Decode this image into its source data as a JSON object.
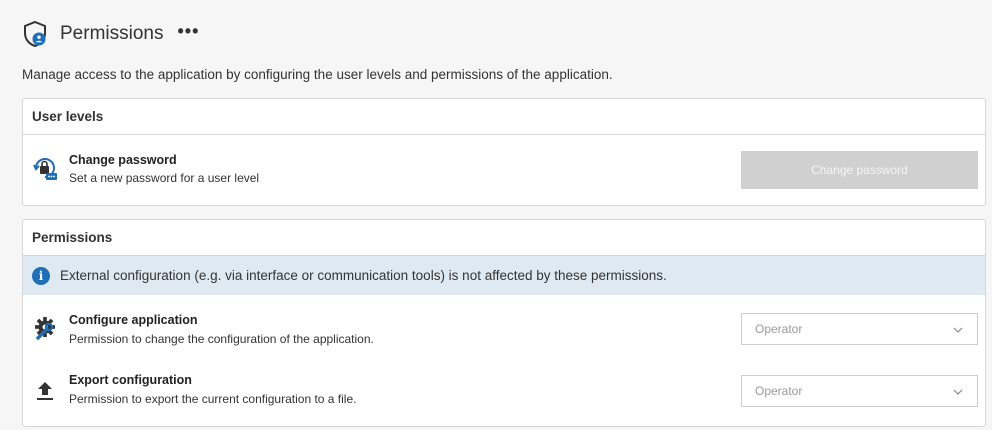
{
  "header": {
    "title": "Permissions",
    "more_label": "•••",
    "icon": "shield-user-icon"
  },
  "description": "Manage access to the application by configuring the user levels and permissions of the application.",
  "user_levels": {
    "heading": "User levels",
    "items": [
      {
        "icon": "lock-password-icon",
        "title": "Change password",
        "subtitle": "Set a new password for a user level",
        "button_label": "Change password",
        "button_enabled": false
      }
    ]
  },
  "permissions": {
    "heading": "Permissions",
    "info": {
      "icon": "info-icon",
      "text": "External configuration (e.g. via interface or communication tools) is not affected by these permissions."
    },
    "items": [
      {
        "icon": "gear-wrench-icon",
        "title": "Configure application",
        "subtitle": "Permission to change the configuration of the application.",
        "selected": "Operator"
      },
      {
        "icon": "upload-icon",
        "title": "Export configuration",
        "subtitle": "Permission to export the current configuration to a file.",
        "selected": "Operator"
      }
    ]
  },
  "colors": {
    "accent": "#1f6fb6",
    "info_bg": "#dfe9f2",
    "disabled_button": "#d0d0d0",
    "page_bg": "#f6f6f6"
  }
}
